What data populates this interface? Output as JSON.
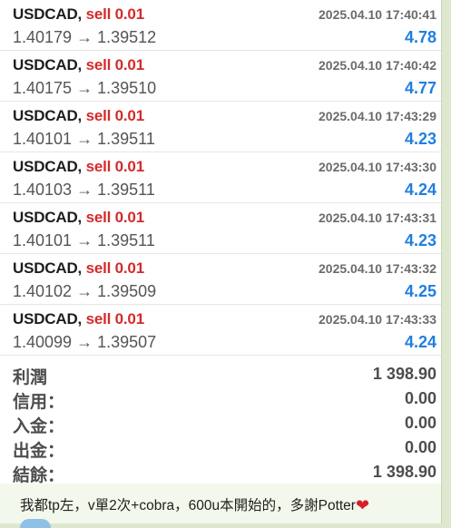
{
  "trades": [
    {
      "symbol": "USDCAD,",
      "side": "sell 0.01",
      "time": "2025.04.10 17:40:41",
      "open": "1.40179",
      "close": "1.39512",
      "arrow": "→",
      "profit": "4.78"
    },
    {
      "symbol": "USDCAD,",
      "side": "sell 0.01",
      "time": "2025.04.10 17:40:42",
      "open": "1.40175",
      "close": "1.39510",
      "arrow": "→",
      "profit": "4.77"
    },
    {
      "symbol": "USDCAD,",
      "side": "sell 0.01",
      "time": "2025.04.10 17:43:29",
      "open": "1.40101",
      "close": "1.39511",
      "arrow": "→",
      "profit": "4.23"
    },
    {
      "symbol": "USDCAD,",
      "side": "sell 0.01",
      "time": "2025.04.10 17:43:30",
      "open": "1.40103",
      "close": "1.39511",
      "arrow": "→",
      "profit": "4.24"
    },
    {
      "symbol": "USDCAD,",
      "side": "sell 0.01",
      "time": "2025.04.10 17:43:31",
      "open": "1.40101",
      "close": "1.39511",
      "arrow": "→",
      "profit": "4.23"
    },
    {
      "symbol": "USDCAD,",
      "side": "sell 0.01",
      "time": "2025.04.10 17:43:32",
      "open": "1.40102",
      "close": "1.39509",
      "arrow": "→",
      "profit": "4.25"
    },
    {
      "symbol": "USDCAD,",
      "side": "sell 0.01",
      "time": "2025.04.10 17:43:33",
      "open": "1.40099",
      "close": "1.39507",
      "arrow": "→",
      "profit": "4.24"
    }
  ],
  "summary": {
    "profit_label": "利潤",
    "profit_value": "1 398.90",
    "credit_label": "信用：",
    "credit_value": "0.00",
    "deposit_label": "入金：",
    "deposit_value": "0.00",
    "withdraw_label": "出金：",
    "withdraw_value": "0.00",
    "balance_label": "結餘：",
    "balance_value": "1 398.90"
  },
  "message": {
    "text": "我都tp左，v單2次+cobra，600u本開始的，多謝Potter",
    "heart_icon": "heart-icon"
  },
  "colors": {
    "sell": "#d32b2b",
    "profit": "#1f7fe0",
    "chat_background": "#dde8cf"
  }
}
